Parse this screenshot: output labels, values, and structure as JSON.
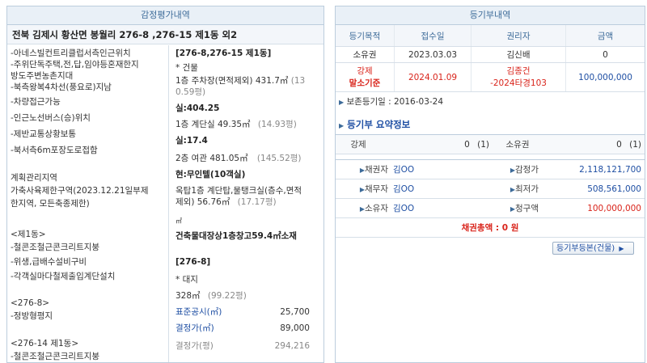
{
  "left": {
    "header": "감정평가내역",
    "address": "전북 김제시 황산면 봉월리 276-8 ,276-15 제1동 외2",
    "col1": [
      "-아네스빌컨트리클럽서측인근위치",
      "-주위단독주택,전,답,임야등혼재한지",
      "방도주변농촌지대",
      "-북측왕복4차선(풍요로)지남",
      "-차량접근가능",
      "-인근노선버스(승)위치",
      "-제반교통상황보통",
      "-북서측6m포장도로접함",
      "계획관리지역",
      "가축사육제한구역(2023.12.21일부제",
      "한지역, 모든축종제한)",
      "<제1동>",
      "-철콘조철근콘크리트지붕",
      "-위생,급배수설비구비",
      "-각객실마다철제출입계단설치",
      "<276-8>",
      "-정방형평지",
      "<276-14 제1동>",
      "-철콘조철근콘크리트지붕"
    ],
    "col2": {
      "parcel1": "[276-8,276-15 제1동]",
      "bldg_label": "* 건물",
      "floor1_main": "1층 주차장(면적제외) 431.7㎡",
      "floor1_py_a": "(13",
      "floor1_py_b": "0.59평)",
      "real1": "실:404.25",
      "floor1b_main": "1층 계단실 49.35㎡",
      "floor1b_py": "(14.93평)",
      "real2": "실:17.4",
      "floor2_main": "2층 여관 481.05㎡",
      "floor2_py": "(145.52평)",
      "current_use": "현:무인텔(10객실)",
      "roof_a": "옥탑1층 계단탑,물탱크실(층수,면적",
      "roof_b_main": "제외) 56.76㎡",
      "roof_b_py": "(17.17평)",
      "unit_m2": "㎡",
      "unlisted": "건축물대장상1층창고59.4㎡소재",
      "parcel2": "[276-8]",
      "land_label": "* 대지",
      "land_main": "328㎡",
      "land_py": "(99.22평)",
      "official_label": "표준공시(㎡)",
      "official_value": "25,700",
      "appraisal_m2_label": "결정가(㎡)",
      "appraisal_m2_value": "89,000",
      "appraisal_py_label": "결정가(평)",
      "appraisal_py_value": "294,216"
    }
  },
  "right": {
    "header": "등기부내역",
    "columns": [
      "등기목적",
      "접수일",
      "권리자",
      "금액"
    ],
    "rows": [
      {
        "purpose": "소유권",
        "date": "2023.03.03",
        "holder": "김신배",
        "amount": "0"
      },
      {
        "purpose_a": "강제",
        "purpose_b": "말소기준",
        "date": "2024.01.09",
        "holder_a": "김종건",
        "holder_b": "-2024타경103",
        "amount": "100,000,000"
      }
    ],
    "preservation": "보존등기일 : 2016-03-24",
    "summary_title": "등기부 요약정보",
    "summary_top": [
      {
        "label": "강제",
        "value": "0",
        "count": "(1)"
      },
      {
        "label": "소유권",
        "value": "0",
        "count": "(1)"
      }
    ],
    "summary_rows": [
      {
        "l_label": "채권자",
        "l_value": "김OO",
        "r_label": "감정가",
        "r_value": "2,118,121,700"
      },
      {
        "l_label": "채무자",
        "l_value": "김OO",
        "r_label": "최저가",
        "r_value": "508,561,000"
      },
      {
        "l_label": "소유자",
        "l_value": "김OO",
        "r_label": "청구액",
        "r_value": "100,000,000"
      }
    ],
    "total_claims": "채권총액 : 0 원",
    "view_button": "등기부등본(건물)"
  }
}
